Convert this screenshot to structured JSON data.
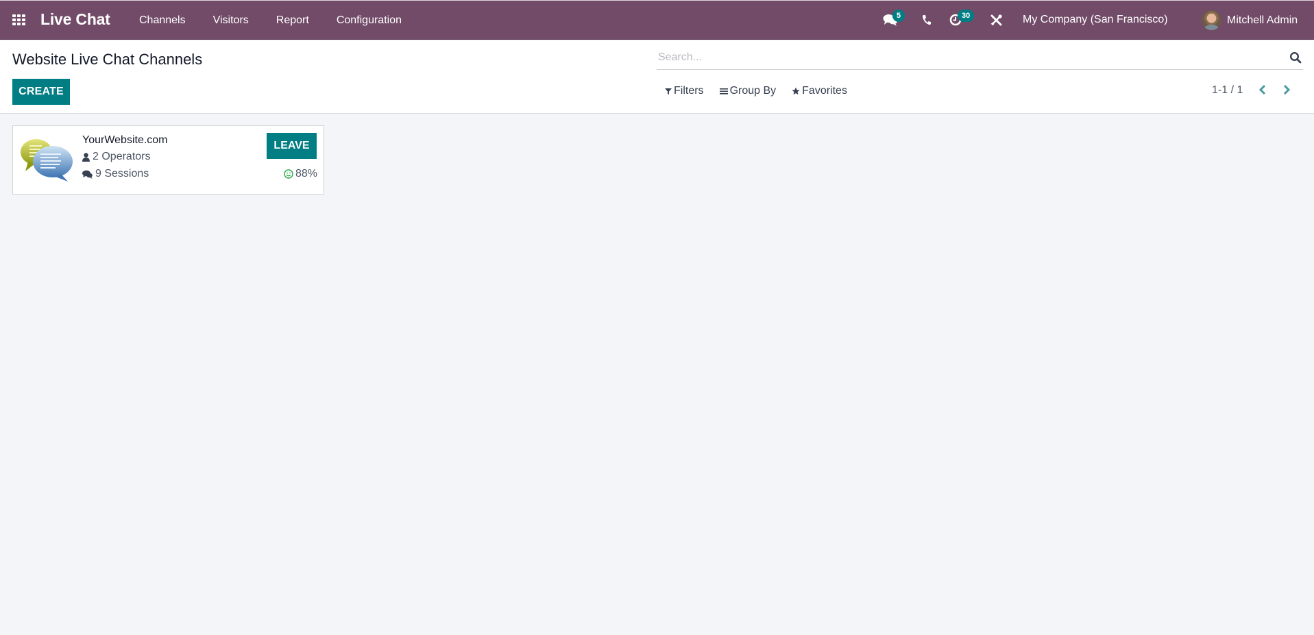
{
  "navbar": {
    "app_name": "Live Chat",
    "menu": [
      {
        "label": "Channels"
      },
      {
        "label": "Visitors"
      },
      {
        "label": "Report"
      },
      {
        "label": "Configuration"
      }
    ],
    "systray": {
      "messages_badge": "5",
      "activities_badge": "30",
      "company": "My Company (San Francisco)",
      "user_name": "Mitchell Admin"
    },
    "colors": {
      "brand": "#714b67",
      "accent": "#017e84"
    }
  },
  "control_panel": {
    "title": "Website Live Chat Channels",
    "create_label": "CREATE",
    "search_placeholder": "Search...",
    "filters_label": "Filters",
    "group_by_label": "Group By",
    "favorites_label": "Favorites",
    "pager_value": "1-1 / 1"
  },
  "channels": [
    {
      "name": "YourWebsite.com",
      "operators": "2 Operators",
      "sessions": "9 Sessions",
      "rating": "88%",
      "action_label": "LEAVE"
    }
  ]
}
